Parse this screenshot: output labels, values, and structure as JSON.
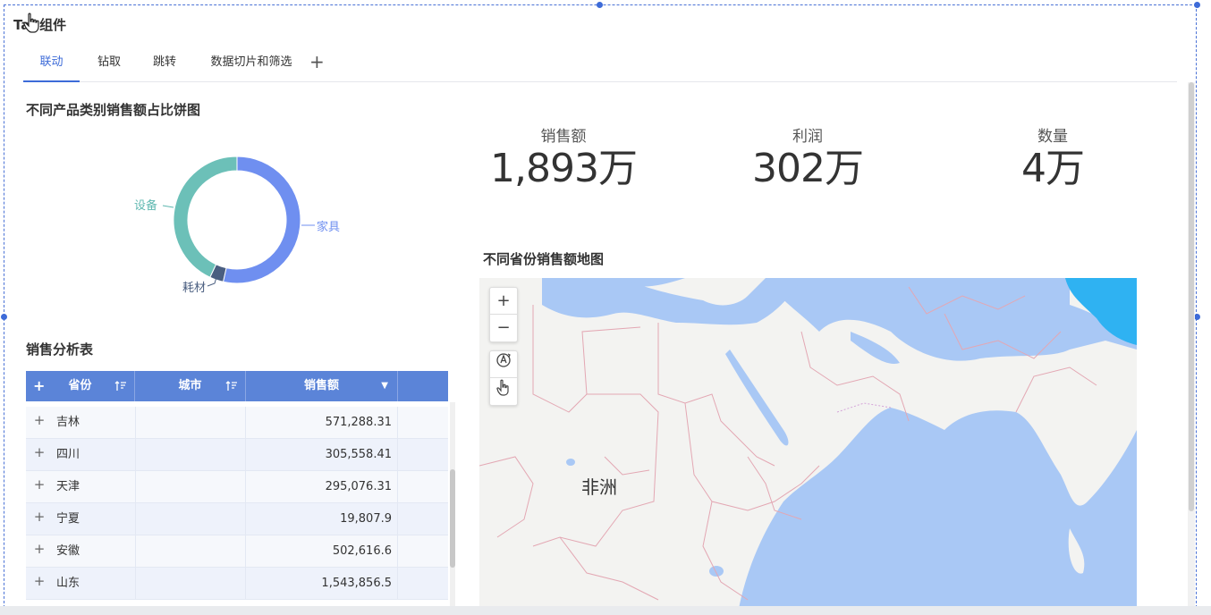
{
  "widget": {
    "title": "Tab组件"
  },
  "tabs": [
    {
      "label": "联动",
      "active": true
    },
    {
      "label": "钻取",
      "active": false
    },
    {
      "label": "跳转",
      "active": false
    },
    {
      "label": "数据切片和筛选",
      "active": false
    }
  ],
  "tab_add_label": "+",
  "pie": {
    "title": "不同产品类别销售额占比饼图",
    "slices": [
      {
        "name": "家具",
        "share": 0.535,
        "color": "#6f8ff0"
      },
      {
        "name": "耗材",
        "share": 0.035,
        "color": "#4a5e80"
      },
      {
        "name": "设备",
        "share": 0.43,
        "color": "#6cc0b8"
      }
    ]
  },
  "kpis": [
    {
      "label": "销售额",
      "value": "1,893万"
    },
    {
      "label": "利润",
      "value": "302万"
    },
    {
      "label": "数量",
      "value": "4万"
    }
  ],
  "table": {
    "title": "销售分析表",
    "headers": {
      "plus": "+",
      "province": "省份",
      "city": "城市",
      "sales": "销售额",
      "sales_sort": "▼"
    },
    "rows": [
      {
        "province": "吉林",
        "city": "",
        "sales": "571,288.31"
      },
      {
        "province": "四川",
        "city": "",
        "sales": "305,558.41"
      },
      {
        "province": "天津",
        "city": "",
        "sales": "295,076.31"
      },
      {
        "province": "宁夏",
        "city": "",
        "sales": "19,807.9"
      },
      {
        "province": "安徽",
        "city": "",
        "sales": "502,616.6"
      },
      {
        "province": "山东",
        "city": "",
        "sales": "1,543,856.5"
      }
    ],
    "row_plus": "+"
  },
  "map": {
    "title": "不同省份销售额地图",
    "zoom_in": "+",
    "zoom_out": "−",
    "region_label": "非洲",
    "colors": {
      "water": "#a9c8f5",
      "land": "#f3f3f1",
      "border": "#e3a7b3",
      "highlight": "#2fb2f2"
    }
  }
}
